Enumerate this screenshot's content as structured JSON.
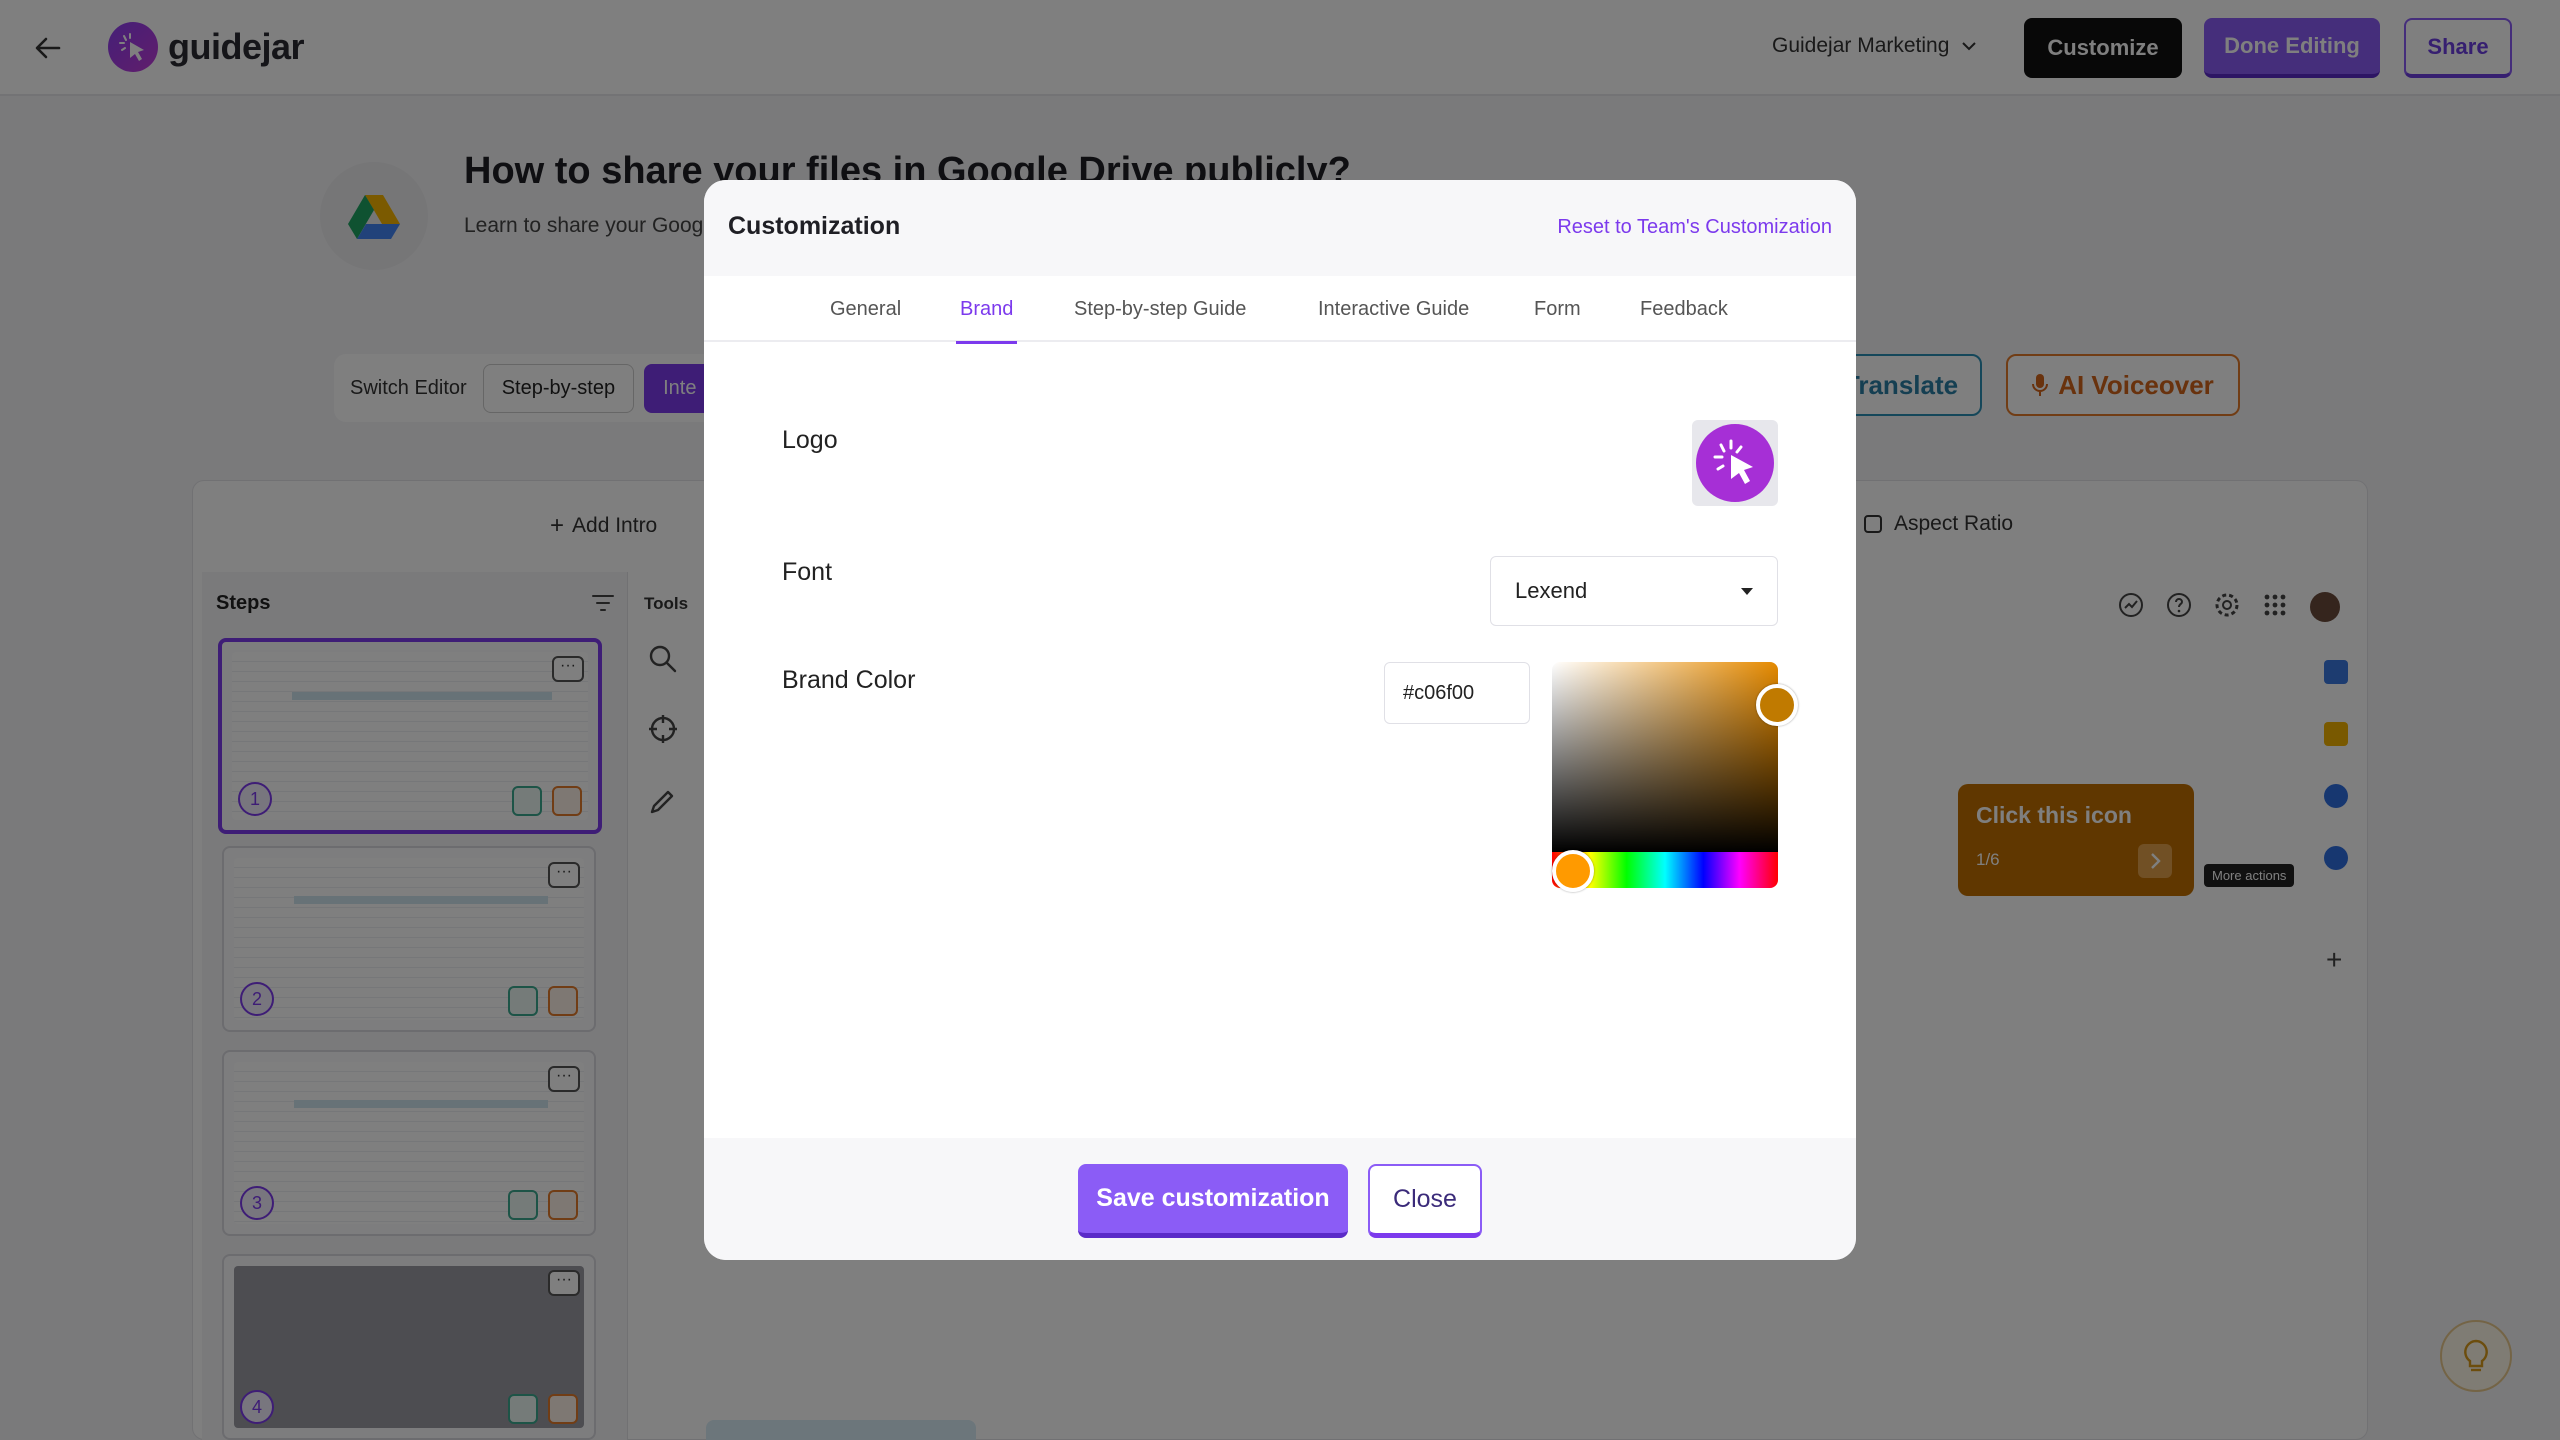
{
  "app": {
    "brand_name": "guidejar",
    "workspace": "Guidejar Marketing",
    "buttons": {
      "customize": "Customize",
      "done_editing": "Done Editing",
      "share": "Share"
    }
  },
  "guide": {
    "title": "How to share your files in Google Drive publicly?",
    "description": "Learn to share your Goog"
  },
  "editor_switch": {
    "label": "Switch Editor",
    "options": [
      "Step-by-step",
      "Inte"
    ]
  },
  "actions": {
    "translate": "Translate",
    "voiceover": "AI Voiceover",
    "add_intro": "Add Intro",
    "aspect_ratio": "Aspect Ratio"
  },
  "steps": {
    "title": "Steps",
    "numbers": [
      "1",
      "2",
      "3",
      "4"
    ]
  },
  "tools": {
    "title": "Tools"
  },
  "tooltip": {
    "text": "Click this icon",
    "count": "1/6",
    "more_actions": "More actions",
    "color": "#c06f00"
  },
  "modal": {
    "title": "Customization",
    "reset_link": "Reset to Team's Customization",
    "tabs": [
      "General",
      "Brand",
      "Step-by-step Guide",
      "Interactive Guide",
      "Form",
      "Feedback"
    ],
    "active_tab": "Brand",
    "logo_label": "Logo",
    "font_label": "Font",
    "font_value": "Lexend",
    "brand_color_label": "Brand Color",
    "brand_color_value": "#c06f00",
    "save_label": "Save customization",
    "close_label": "Close"
  },
  "colors": {
    "accent": "#7c3aed",
    "brand": "#c06f00"
  }
}
